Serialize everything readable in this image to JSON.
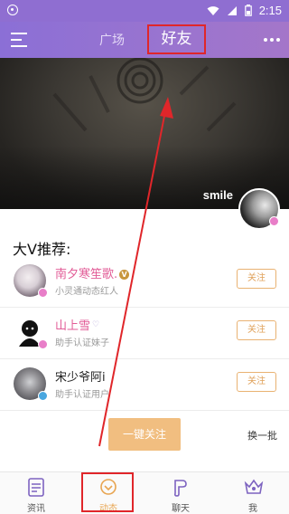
{
  "status_bar": {
    "time": "2:15"
  },
  "header": {
    "tabs": [
      "广场",
      "好友"
    ],
    "active_tab": "好友"
  },
  "banner": {
    "username": "smile"
  },
  "recommend": {
    "title": "大V推荐:",
    "items": [
      {
        "name": "南夕寒笙歌.",
        "desc": "小灵通动态红人",
        "follow": "关注",
        "name_color": "#e25c97"
      },
      {
        "name": "山上雪",
        "desc": "助手认证妹子",
        "follow": "关注",
        "name_color": "#e25c97"
      },
      {
        "name": "宋少爷阿i",
        "desc": "助手认证用户",
        "follow": "关注",
        "name_color": "#222222"
      }
    ]
  },
  "actions": {
    "follow_all": "一键关注",
    "refresh": "换一批"
  },
  "bottom_nav": {
    "items": [
      {
        "label": "资讯",
        "icon": "news-icon"
      },
      {
        "label": "动态",
        "icon": "moments-icon"
      },
      {
        "label": "聊天",
        "icon": "chat-icon"
      },
      {
        "label": "我",
        "icon": "profile-icon"
      }
    ],
    "active": "动态"
  },
  "colors": {
    "accent": "#9a74cf",
    "follow_button": "#f1be80",
    "highlight": "#e0262a"
  }
}
